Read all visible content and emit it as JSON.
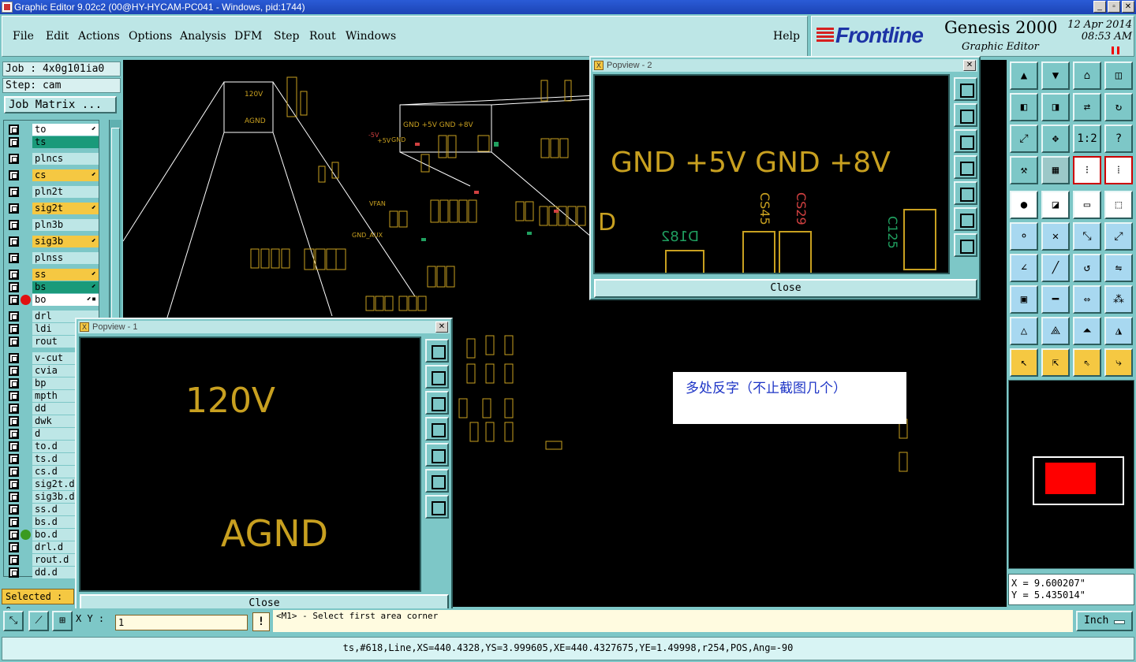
{
  "window": {
    "title": "Graphic Editor 9.02c2 (00@HY-HYCAM-PC041 - Windows, pid:1744)",
    "minimize": "_",
    "maximize": "▫",
    "close": "✕"
  },
  "menu": {
    "items": [
      "File",
      "Edit",
      "Actions",
      "Options",
      "Analysis",
      "DFM",
      "Step",
      "Rout",
      "Windows"
    ],
    "help": "Help"
  },
  "brand": {
    "logo": "Frontline",
    "product": "Genesis 2000",
    "subtitle": "Graphic Editor",
    "date": "12 Apr 2014",
    "time": "08:53 AM"
  },
  "job": {
    "job_label": "Job : 4x0g101ia0",
    "step_label": "Step: cam",
    "matrix_button": "Job Matrix ..."
  },
  "layers": [
    {
      "name": "to",
      "color": "#ffffff",
      "mark": "⬋"
    },
    {
      "name": "ts",
      "color": "#1a9a7a",
      "mark": ""
    },
    {
      "name": "plncs",
      "color": "#bde6e6",
      "mark": ""
    },
    {
      "name": "cs",
      "color": "#f5c842",
      "mark": "⬋"
    },
    {
      "name": "pln2t",
      "color": "#bde6e6",
      "mark": ""
    },
    {
      "name": "sig2t",
      "color": "#f5c842",
      "mark": "⬋"
    },
    {
      "name": "pln3b",
      "color": "#bde6e6",
      "mark": ""
    },
    {
      "name": "sig3b",
      "color": "#f5c842",
      "mark": "⬋"
    },
    {
      "name": "plnss",
      "color": "#bde6e6",
      "mark": ""
    },
    {
      "name": "ss",
      "color": "#f5c842",
      "mark": "⬋"
    },
    {
      "name": "bs",
      "color": "#1a9a7a",
      "mark": "⬋"
    },
    {
      "name": "bo",
      "color": "#ffffff",
      "mark": "⬋▪"
    },
    {
      "name": "drl",
      "color": "#bde6e6",
      "mark": ""
    },
    {
      "name": "ldi",
      "color": "#bde6e6",
      "mark": ""
    },
    {
      "name": "rout",
      "color": "#bde6e6",
      "mark": ""
    },
    {
      "name": "v-cut",
      "color": "#bde6e6",
      "mark": ""
    },
    {
      "name": "cvia",
      "color": "#bde6e6",
      "mark": ""
    },
    {
      "name": "bp",
      "color": "#bde6e6",
      "mark": ""
    },
    {
      "name": "mpth",
      "color": "#bde6e6",
      "mark": ""
    },
    {
      "name": "dd",
      "color": "#bde6e6",
      "mark": ""
    },
    {
      "name": "dwk",
      "color": "#bde6e6",
      "mark": ""
    },
    {
      "name": "d",
      "color": "#bde6e6",
      "mark": ""
    },
    {
      "name": "to.d",
      "color": "#bde6e6",
      "mark": ""
    },
    {
      "name": "ts.d",
      "color": "#bde6e6",
      "mark": ""
    },
    {
      "name": "cs.d",
      "color": "#bde6e6",
      "mark": ""
    },
    {
      "name": "sig2t.d",
      "color": "#bde6e6",
      "mark": ""
    },
    {
      "name": "sig3b.d",
      "color": "#bde6e6",
      "mark": ""
    },
    {
      "name": "ss.d",
      "color": "#bde6e6",
      "mark": ""
    },
    {
      "name": "bs.d",
      "color": "#bde6e6",
      "mark": ""
    },
    {
      "name": "bo.d",
      "color": "#bde6e6",
      "mark": ""
    },
    {
      "name": "drl.d",
      "color": "#bde6e6",
      "mark": ""
    },
    {
      "name": "rout.d",
      "color": "#bde6e6",
      "mark": ""
    },
    {
      "name": "dd.d",
      "color": "#bde6e6",
      "mark": ""
    }
  ],
  "selected": "Selected : 0",
  "canvas": {
    "labels": {
      "v120": "120V",
      "agnd": "AGND",
      "rail": "GND +5V GND +8V",
      "m5v": "-5V",
      "p5v": "+5V",
      "gnd": "GND",
      "vfan": "VFAN",
      "gnd_aux": "GND_AUX"
    },
    "note": "多处反字（不止截图几个）"
  },
  "popview1": {
    "title": "Popview - 1",
    "line1": "120V",
    "line2": "AGND",
    "close": "Close"
  },
  "popview2": {
    "title": "Popview - 2",
    "rail": "GND +5V GND +8V",
    "d": "D",
    "d182": "D182",
    "cs45": "CS45",
    "cs29": "CS29",
    "c125": "C125",
    "close": "Close"
  },
  "toolbox": {
    "ratio": "1:2",
    "help": "?"
  },
  "coords": {
    "x": "X =  9.600207\"",
    "y": "Y =  5.435014\""
  },
  "bottom": {
    "xy_label": "X Y :",
    "xy_value": "1",
    "msg_icon": "!",
    "message": "<M1> - Select first area corner",
    "units": "Inch"
  },
  "status": "ts,#618,Line,XS=440.4328,YS=3.999605,XE=440.4327675,YE=1.49998,r254,POS,Ang=-90"
}
